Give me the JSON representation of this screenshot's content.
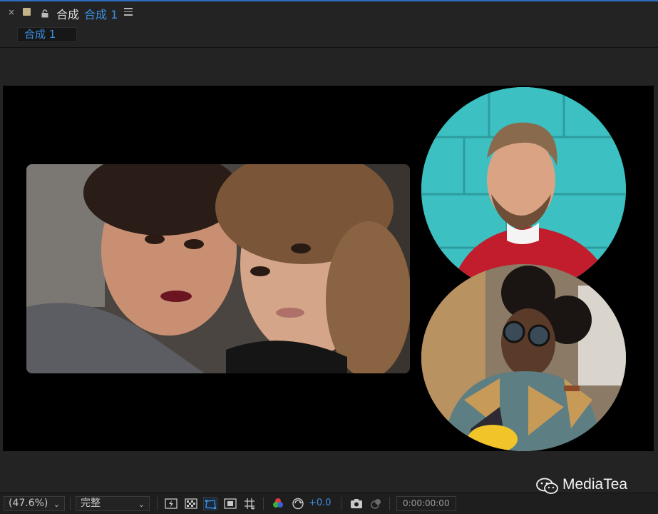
{
  "panel": {
    "close_glyph": "×",
    "title_prefix": "合成",
    "title_name": "合成 1",
    "tab_label": "合成 1"
  },
  "toolbar": {
    "zoom": "(47.6%)",
    "resolution": "完整",
    "exposure": "+0.0",
    "timecode": "0:00:00:00"
  },
  "watermark": {
    "text": "MediaTea"
  },
  "colors": {
    "accent": "#3b8fe0",
    "panel_bg": "#232323",
    "canvas_bg": "#000000"
  },
  "icons": [
    "close-icon",
    "label-color-swatch",
    "lock-icon",
    "panel-menu-icon",
    "chevron-down-icon",
    "fast-preview-icon",
    "transparency-grid-icon",
    "mask-visibility-icon",
    "region-of-interest-icon",
    "guides-icon",
    "color-channels-icon",
    "reset-exposure-icon",
    "snapshot-icon",
    "show-snapshot-icon",
    "wechat-icon"
  ]
}
